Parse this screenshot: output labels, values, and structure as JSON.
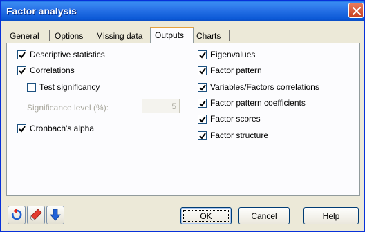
{
  "window": {
    "title": "Factor analysis"
  },
  "tabs": [
    {
      "label": "General"
    },
    {
      "label": "Options"
    },
    {
      "label": "Missing data"
    },
    {
      "label": "Outputs",
      "active": true
    },
    {
      "label": "Charts"
    }
  ],
  "outputs": {
    "left": {
      "descriptive_statistics": {
        "label": "Descriptive statistics",
        "checked": true
      },
      "correlations": {
        "label": "Correlations",
        "checked": true
      },
      "test_significancy": {
        "label": "Test significancy",
        "checked": false
      },
      "significance_level": {
        "label": "Significance level (%):",
        "value": "5",
        "enabled": false
      },
      "cronbachs_alpha": {
        "label": "Cronbach's alpha",
        "checked": true
      }
    },
    "right": {
      "eigenvalues": {
        "label": "Eigenvalues",
        "checked": true
      },
      "factor_pattern": {
        "label": "Factor pattern",
        "checked": true
      },
      "variables_factors_correlations": {
        "label": "Variables/Factors correlations",
        "checked": true
      },
      "factor_pattern_coefficients": {
        "label": "Factor pattern coefficients",
        "checked": true
      },
      "factor_scores": {
        "label": "Factor scores",
        "checked": true
      },
      "factor_structure": {
        "label": "Factor structure",
        "checked": true
      }
    }
  },
  "footer": {
    "icons": [
      "reset-icon",
      "eraser-icon",
      "down-arrow-icon"
    ],
    "ok_label": "OK",
    "cancel_label": "Cancel",
    "help_label": "Help"
  },
  "colors": {
    "title_bar": "#0b59d6",
    "active_tab_accent": "#e6a23c",
    "panel_bg": "#fcfcfe",
    "dialog_bg": "#ece9d8"
  }
}
